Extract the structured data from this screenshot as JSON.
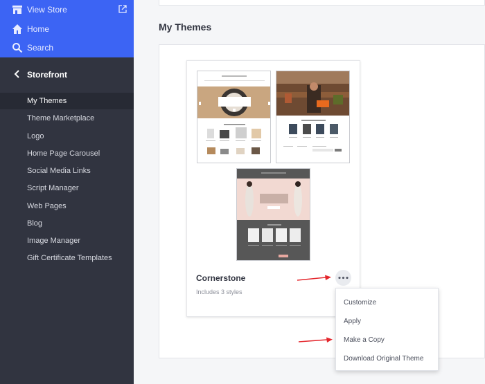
{
  "sidebar": {
    "top_items": [
      {
        "label": "View Store",
        "icon": "store-icon"
      },
      {
        "label": "Home",
        "icon": "home-icon"
      },
      {
        "label": "Search",
        "icon": "search-icon"
      }
    ],
    "section_title": "Storefront",
    "items": [
      {
        "label": "My Themes"
      },
      {
        "label": "Theme Marketplace"
      },
      {
        "label": "Logo"
      },
      {
        "label": "Home Page Carousel"
      },
      {
        "label": "Social Media Links"
      },
      {
        "label": "Script Manager"
      },
      {
        "label": "Web Pages"
      },
      {
        "label": "Blog"
      },
      {
        "label": "Image Manager"
      },
      {
        "label": "Gift Certificate Templates"
      }
    ]
  },
  "main": {
    "title": "My Themes",
    "theme": {
      "name": "Cornerstone",
      "subtitle": "Includes 3 styles",
      "thumbnails": [
        {
          "banner_text": "Books for Cooks",
          "section_text": "Most Popular Products"
        },
        {
          "section_text": "New Arrivals"
        },
        {
          "banner_text": "Spring Delivered"
        }
      ]
    },
    "menu": [
      {
        "label": "Customize"
      },
      {
        "label": "Apply"
      },
      {
        "label": "Make a Copy"
      },
      {
        "label": "Download Original Theme"
      }
    ]
  },
  "colors": {
    "sidebar_top_bg": "#3c64f4",
    "sidebar_bg": "#313440",
    "annotation_arrow": "#e4262c"
  }
}
